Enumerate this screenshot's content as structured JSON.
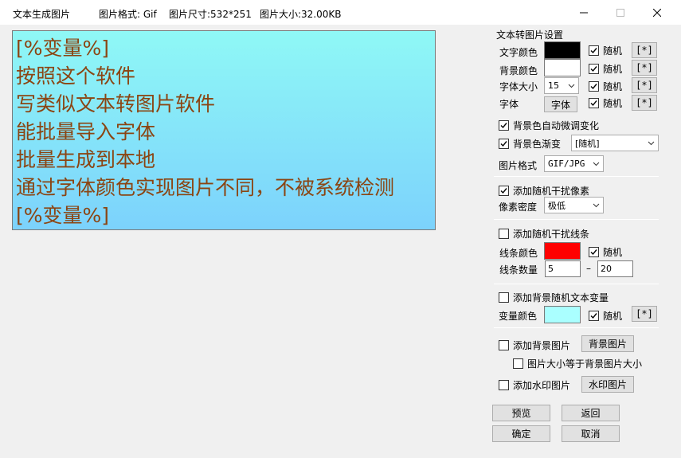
{
  "window": {
    "title": "文本生成图片",
    "format_info": "图片格式: Gif",
    "size_info": "图片尺寸:532*251",
    "filesize_info": "图片大小:32.00KB"
  },
  "preview": {
    "lines": [
      "[%变量%]",
      "按照这个软件",
      "写类似文本转图片软件",
      "能批量导入字体",
      "批量生成到本地",
      "通过字体颜色实现图片不同，不被系统检测",
      "[%变量%]"
    ],
    "text_color": "#8b4513",
    "bg_color_top": "#8ff8f6",
    "bg_color_bottom": "#7cd2fc"
  },
  "settings": {
    "group_title": "文本转图片设置",
    "text_color_label": "文字颜色",
    "text_color": "#000000",
    "bg_color_label": "背景颜色",
    "bg_color": "#ffffff",
    "font_size_label": "字体大小",
    "font_size_value": "15",
    "font_label": "字体",
    "font_button": "字体",
    "random_label": "随机",
    "random_button": "[*]",
    "auto_adjust_label": "背景色自动微调变化",
    "gradient_label": "背景色渐变",
    "gradient_value": "[随机]",
    "format_label": "图片格式",
    "format_value": "GIF/JPG",
    "noise_pixel_label": "添加随机干扰像素",
    "pixel_density_label": "像素密度",
    "pixel_density_value": "极低",
    "noise_line_label": "添加随机干扰线条",
    "line_color_label": "线条颜色",
    "line_color": "#ff0000",
    "line_count_label": "线条数量",
    "line_count_min": "5",
    "line_count_sep": "–",
    "line_count_max": "20",
    "bg_var_label": "添加背景随机文本变量",
    "var_color_label": "变量颜色",
    "var_color": "#aaffff",
    "bg_image_label": "添加背景图片",
    "bg_image_button": "背景图片",
    "bg_size_label": "图片大小等于背景图片大小",
    "watermark_label": "添加水印图片",
    "watermark_button": "水印图片"
  },
  "actions": {
    "preview": "预览",
    "back": "返回",
    "ok": "确定",
    "cancel": "取消"
  }
}
